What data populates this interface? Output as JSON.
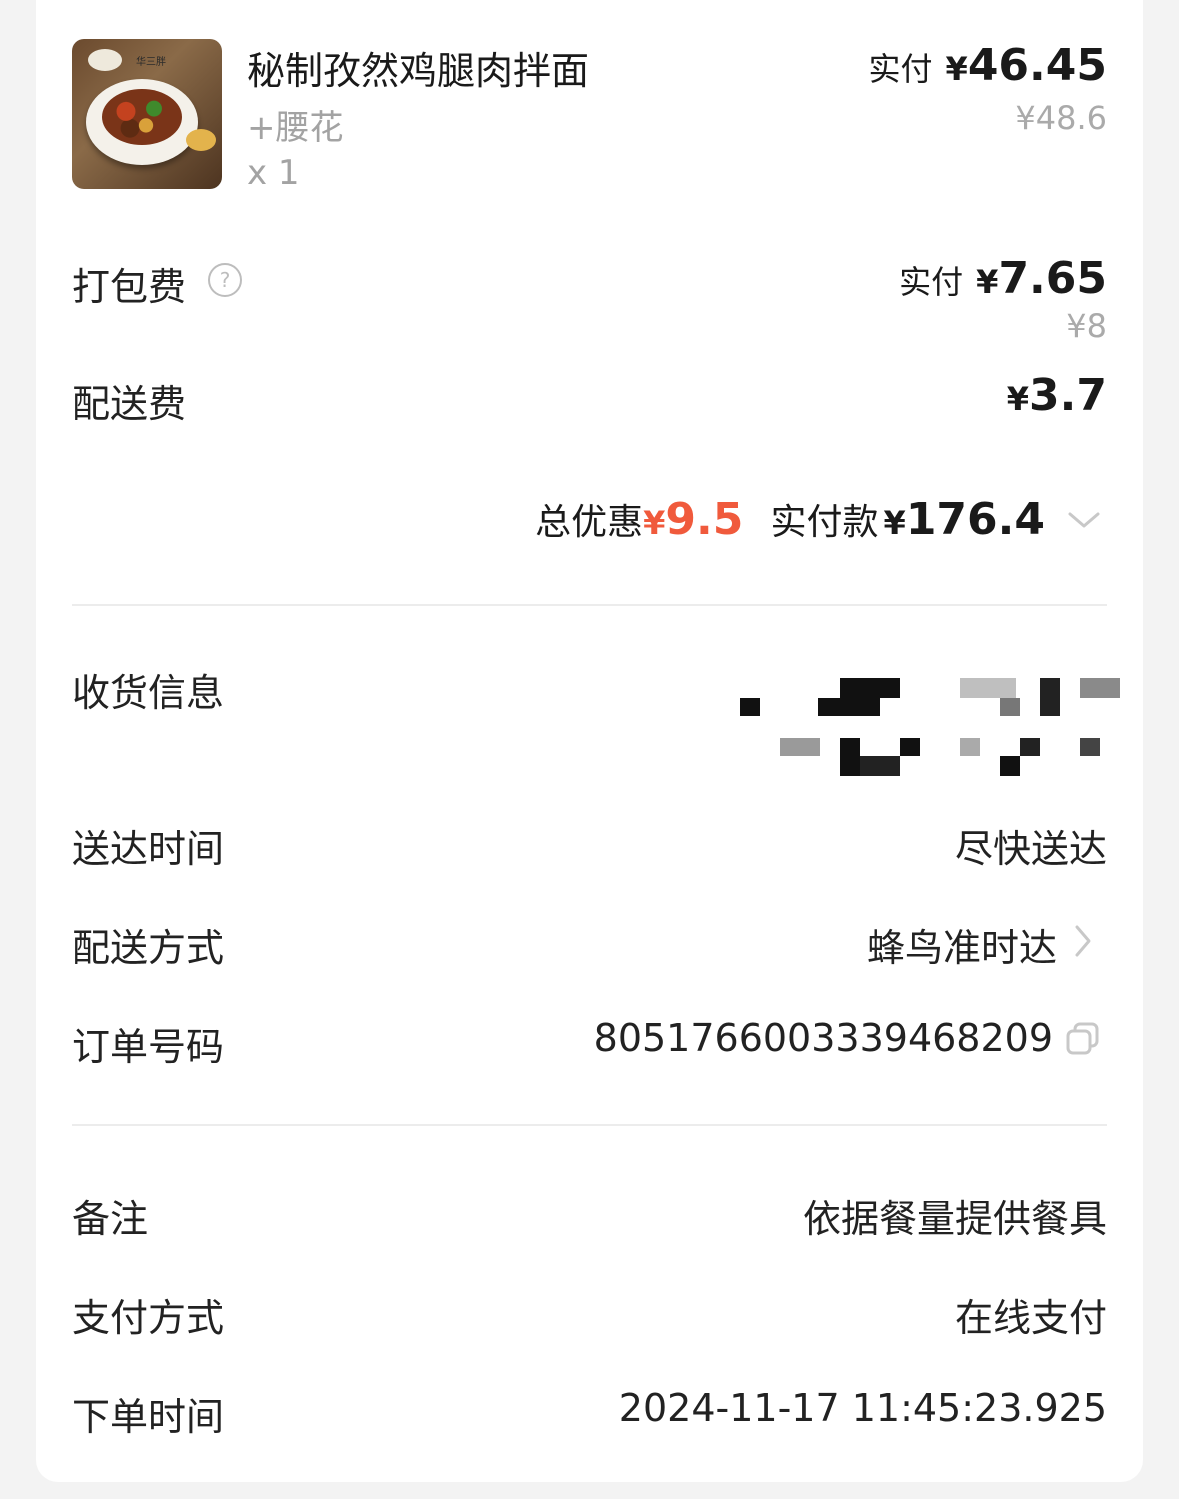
{
  "item": {
    "name": "秘制孜然鸡腿肉拌面",
    "addon": "+腰花",
    "qty": "x 1",
    "paid_label": "实付",
    "currency": "¥",
    "paid_value": "46.45",
    "original": "¥48.6",
    "image_icon": "food-photo"
  },
  "packing": {
    "label": "打包费",
    "help_icon": "?",
    "paid_label": "实付",
    "currency": "¥",
    "paid_value": "7.65",
    "original": "¥8"
  },
  "delivery_fee": {
    "label": "配送费",
    "currency": "¥",
    "value": "3.7"
  },
  "summary": {
    "discount_label": "总优惠",
    "discount_currency": "¥",
    "discount_value": "9.5",
    "total_label": "实付款",
    "total_currency": "¥",
    "total_value": "176.4"
  },
  "info": {
    "receiver_label": "收货信息",
    "delivery_time_label": "送达时间",
    "delivery_time_value": "尽快送达",
    "delivery_method_label": "配送方式",
    "delivery_method_value": "蜂鸟准时达",
    "order_no_label": "订单号码",
    "order_no_value": "8051766003339468209",
    "note_label": "备注",
    "note_value": "依据餐量提供餐具",
    "payment_label": "支付方式",
    "payment_value": "在线支付",
    "order_time_label": "下单时间",
    "order_time_value": "2024-11-17 11:45:23.925"
  },
  "colors": {
    "accent_red": "#f05a3c",
    "muted_gray": "#a3a3a3",
    "divider": "#ececec"
  }
}
